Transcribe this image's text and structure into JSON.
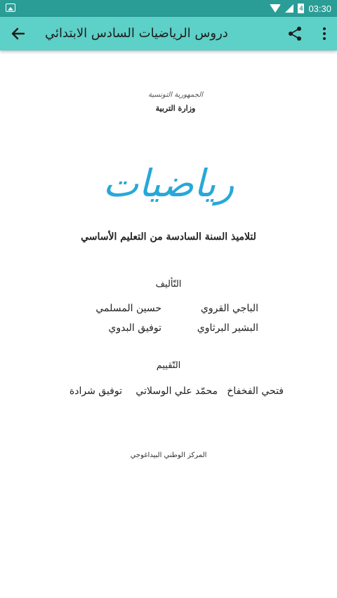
{
  "status_bar": {
    "time": "03:30",
    "battery_label": "4"
  },
  "app_bar": {
    "title": "دروس الرياضيات السادس الابتدائي"
  },
  "page": {
    "republic": "الجمهورية التونسية",
    "ministry": "وزارة التربية",
    "main_title": "رياضيات",
    "subtitle": "لتلاميذ السنة السادسة من التعليم الأساسي",
    "authorship_heading": "التّأليف",
    "authors": [
      "الباجي القروي",
      "حسين المسلمي",
      "البشير البرثاوي",
      "توفيق البدوي"
    ],
    "evaluation_heading": "التّقييم",
    "evaluators": [
      "فتحي الفخفاخ",
      "محمّد علي الوسلاتي",
      "توفيق شرادة"
    ],
    "publisher": "المركز الوطني البيداغوجي"
  },
  "colors": {
    "status_bar": "#2a9d96",
    "app_bar": "#5dd0c7",
    "title_blue": "#27a8d8"
  }
}
